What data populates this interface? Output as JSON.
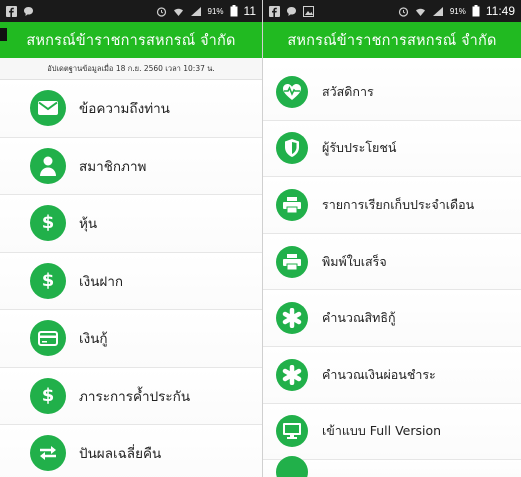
{
  "left_screen": {
    "status": {
      "time": "11",
      "battery": "91%"
    },
    "app_title": "สหกรณ์ข้าราชการสหกรณ์ จำกัด",
    "updated_text": "อัปเดตฐานข้อมูลเมื่อ 18 ก.ย. 2560 เวลา 10:37 น.",
    "menu": [
      {
        "label": "ข้อความถึงท่าน",
        "icon": "envelope-icon"
      },
      {
        "label": "สมาชิกภาพ",
        "icon": "person-icon"
      },
      {
        "label": "หุ้น",
        "icon": "dollar-icon"
      },
      {
        "label": "เงินฝาก",
        "icon": "dollar-icon"
      },
      {
        "label": "เงินกู้",
        "icon": "credit-card-icon"
      },
      {
        "label": "ภาระการค้ำประกัน",
        "icon": "dollar-icon"
      },
      {
        "label": "ปันผลเฉลี่ยคืน",
        "icon": "exchange-icon"
      }
    ]
  },
  "right_screen": {
    "status": {
      "time": "11:49",
      "battery": "91%"
    },
    "app_title": "สหกรณ์ข้าราชการสหกรณ์ จำกัด",
    "menu": [
      {
        "label": "สวัสดิการ",
        "icon": "heartbeat-icon"
      },
      {
        "label": "ผู้รับประโยชน์",
        "icon": "shield-icon"
      },
      {
        "label": "รายการเรียกเก็บประจำเดือน",
        "icon": "printer-icon"
      },
      {
        "label": "พิมพ์ใบเสร็จ",
        "icon": "printer-icon"
      },
      {
        "label": "คำนวณสิทธิกู้",
        "icon": "asterisk-icon"
      },
      {
        "label": "คำนวณเงินผ่อนชำระ",
        "icon": "asterisk-icon"
      },
      {
        "label": "เข้าแบบ Full Version",
        "icon": "monitor-icon"
      }
    ]
  },
  "colors": {
    "accent": "#21ba21",
    "icon_bg": "#21b04a",
    "status_bar": "#1a1a1a"
  }
}
